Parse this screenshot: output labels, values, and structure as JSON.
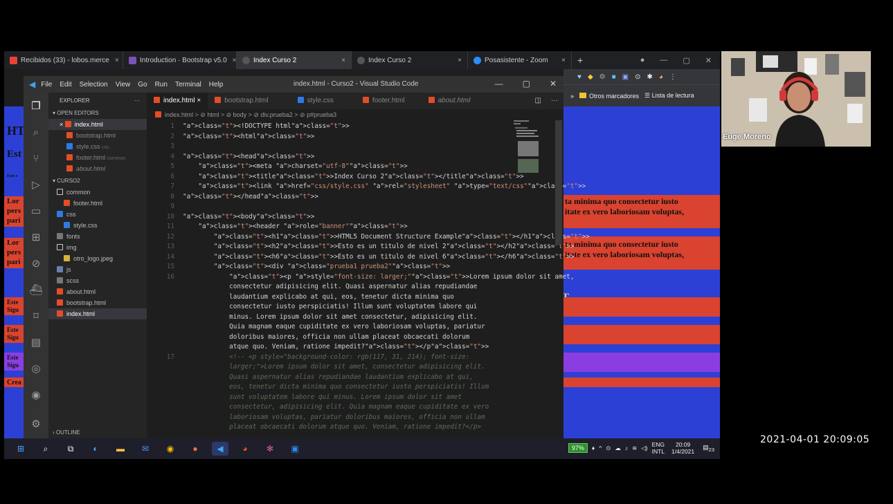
{
  "browser": {
    "tabs": [
      {
        "label": "Recibidos (33) - lobos.merce",
        "icon": "gmail-icon",
        "color": "#ea4335"
      },
      {
        "label": "Introduction · Bootstrap v5.0",
        "icon": "bootstrap-icon",
        "color": "#7952b3"
      },
      {
        "label": "Index Curso 2",
        "icon": "globe-icon",
        "color": "#888888",
        "active": true
      },
      {
        "label": "Index Curso 2",
        "icon": "globe-icon",
        "color": "#888888"
      },
      {
        "label": "Posasistente - Zoom",
        "icon": "zoom-icon",
        "color": "#2d8cff"
      }
    ],
    "new_tab": "+",
    "bookmarks": {
      "chevron": "»",
      "other": "Otros marcadores",
      "reading": "Lista de lectura"
    }
  },
  "vscode": {
    "menu": [
      "File",
      "Edit",
      "Selection",
      "View",
      "Go",
      "Run",
      "Terminal",
      "Help"
    ],
    "window_title": "index.html - Curso2 - Visual Studio Code",
    "tabs": [
      {
        "label": "index.html",
        "close": "×",
        "active": true
      },
      {
        "label": "bootstrap.html"
      },
      {
        "label": "style.css"
      },
      {
        "label": "footer.html"
      },
      {
        "label": "about.html"
      }
    ],
    "breadcrumb": "index.html > ⊘ html > ⊘ body > ⊘ div.prueba2 > ⊘ p#prueba3",
    "explorer": {
      "title": "EXPLORER",
      "open_editors": "OPEN EDITORS",
      "open_files": [
        {
          "name": "index.html",
          "note": "",
          "prefix": "×"
        },
        {
          "name": "bootstrap.html",
          "note": ""
        },
        {
          "name": "style.css",
          "note": "css"
        },
        {
          "name": "footer.html",
          "note": "common"
        },
        {
          "name": "about.html",
          "note": ""
        }
      ],
      "project": "CURSO2",
      "tree": [
        {
          "name": "common",
          "type": "folder",
          "depth": 0
        },
        {
          "name": "footer.html",
          "type": "html",
          "depth": 1
        },
        {
          "name": "css",
          "type": "folder",
          "depth": 0
        },
        {
          "name": "style.css",
          "type": "css",
          "depth": 1
        },
        {
          "name": "fonts",
          "type": "folder",
          "depth": 0
        },
        {
          "name": "img",
          "type": "folder",
          "depth": 0
        },
        {
          "name": "otro_logo.jpeg",
          "type": "img",
          "depth": 1
        },
        {
          "name": "js",
          "type": "folder",
          "depth": 0
        },
        {
          "name": "scss",
          "type": "folder",
          "depth": 0
        },
        {
          "name": "about.html",
          "type": "html",
          "depth": 0
        },
        {
          "name": "bootstrap.html",
          "type": "html",
          "depth": 0
        },
        {
          "name": "index.html",
          "type": "html",
          "depth": 0
        }
      ],
      "outline": "OUTLINE"
    },
    "code_lines": [
      {
        "n": "1",
        "text": "<!DOCTYPE html>"
      },
      {
        "n": "2",
        "text": "<html>"
      },
      {
        "n": "3",
        "text": ""
      },
      {
        "n": "4",
        "text": "<head>"
      },
      {
        "n": "5",
        "text": "    <meta charset=\"utf-8\">"
      },
      {
        "n": "6",
        "text": "    <title>Index Curso 2</title>"
      },
      {
        "n": "7",
        "text": "    <link href=\"css/style.css\" rel=\"stylesheet\" type=\"text/css\">"
      },
      {
        "n": "8",
        "text": "</head>"
      },
      {
        "n": "9",
        "text": ""
      },
      {
        "n": "10",
        "text": "<body>"
      },
      {
        "n": "11",
        "text": "    <header role=\"banner\">"
      },
      {
        "n": "12",
        "text": "        <h1>HTML5 Document Structure Example</h1>"
      },
      {
        "n": "13",
        "text": "        <h2>Esto es un titulo de nivel 2</h2>"
      },
      {
        "n": "14",
        "text": "        <h6>Esto es un titulo de nivel 6</h6>"
      },
      {
        "n": "15",
        "text": "        <div class=\"prueba1 prueba2\">"
      },
      {
        "n": "16",
        "text": "            <p style=\"font-size: larger;\">Lorem ipsum dolor sit amet,"
      },
      {
        "n": "",
        "text": "            consectetur adipisicing elit. Quasi aspernatur alias repudiandae"
      },
      {
        "n": "",
        "text": "            laudantium explicabo at qui, eos, tenetur dicta minima quo"
      },
      {
        "n": "",
        "text": "            consectetur iusto perspiciatis! Illum sunt voluptatem labore qui"
      },
      {
        "n": "",
        "text": "            minus. Lorem ipsum dolor sit amet consectetur, adipisicing elit."
      },
      {
        "n": "",
        "text": "            Quia magnam eaque cupiditate ex vero laboriosam voluptas, pariatur"
      },
      {
        "n": "",
        "text": "            doloribus maiores, officia non ullam placeat obcaecati dolorum"
      },
      {
        "n": "",
        "text": "            atque quo. Veniam, ratione impedit?</p>"
      },
      {
        "n": "17",
        "text": "            <!-- <p style=\"background-color: rgb(117, 31, 214); font-size:",
        "comment": true
      },
      {
        "n": "",
        "text": "            larger;\">Lorem ipsum dolor sit amet, consectetur adipisicing elit.",
        "comment": true
      },
      {
        "n": "",
        "text": "            Quasi aspernatur alias repudiandae laudantium explicabo at qui,",
        "comment": true
      },
      {
        "n": "",
        "text": "            eos, tenetur dicta minima quo consectetur iusto perspiciatis! Illum",
        "comment": true
      },
      {
        "n": "",
        "text": "            sunt voluptatem labore qui minus. Lorem ipsum dolor sit amet",
        "comment": true
      },
      {
        "n": "",
        "text": "            consectetur, adipisicing elit. Quia magnam eaque cupiditate ex vero",
        "comment": true
      },
      {
        "n": "",
        "text": "            laboriosam voluptas, pariatur doloribus maiores, officia non ullam",
        "comment": true
      },
      {
        "n": "",
        "text": "            placeat obcaecati dolorum atque quo. Veniam, ratione impedit?</p>",
        "comment": true
      }
    ]
  },
  "page": {
    "left_fragments": [
      "HT",
      "Est",
      "Esto e",
      "Lor",
      "pers",
      "pari",
      "Lor",
      "pers",
      "pari",
      "Este",
      "Sigu",
      "Este",
      "Sigu",
      "Este",
      "Sigu",
      "Crea"
    ],
    "right_p1": [
      "ta minima quo consectetur iusto",
      "itate ex vero laboriosam voluptas,"
    ],
    "right_p2": [
      "ta minima quo consectetur iusto",
      "itate ex vero laboriosam voluptas,"
    ],
    "right_letter": "T",
    "colors": {
      "blue": "#2c40d6",
      "red": "#d9432f",
      "purple": "#8a3ee0"
    }
  },
  "taskbar": {
    "battery": "97%",
    "lang": "ENG",
    "lang2": "INTL",
    "time": "20:09",
    "date": "1/4/2021",
    "notif": "23"
  },
  "webcam": {
    "name": "Euge Moreno"
  },
  "timestamp": "2021-04-01 20:09:05"
}
